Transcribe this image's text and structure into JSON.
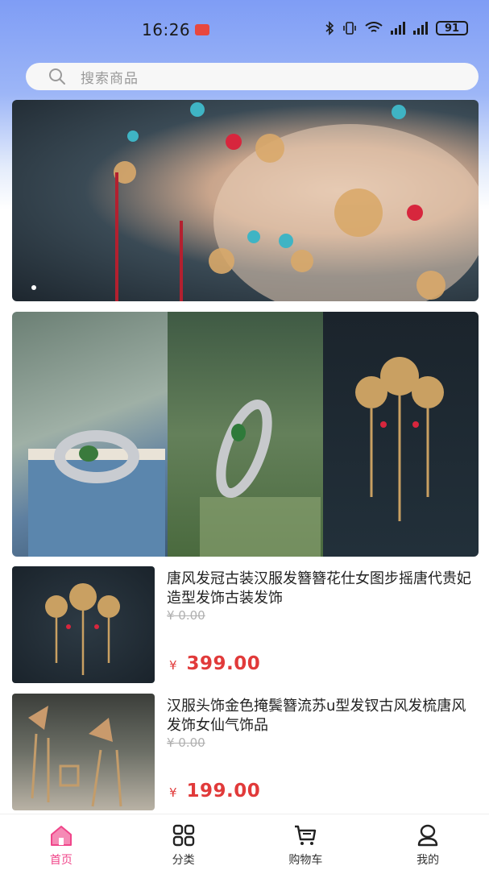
{
  "status_bar": {
    "time": "16:26",
    "battery": "91"
  },
  "search": {
    "placeholder": "搜索商品"
  },
  "colors": {
    "accent": "#f0458a",
    "price": "#e13a3a",
    "header_gradient_top": "#7f9df5"
  },
  "products": [
    {
      "title": "唐风发冠古装汉服发簪簪花仕女图步摇唐代贵妃造型发饰古装发饰",
      "original_price": "¥ 0.00",
      "currency": "¥",
      "price": "399.00"
    },
    {
      "title": "汉服头饰金色掩鬓簪流苏u型发钗古风发梳唐风发饰女仙气饰品",
      "original_price": "¥ 0.00",
      "currency": "¥",
      "price": "199.00"
    }
  ],
  "tabbar": {
    "items": [
      {
        "label": "首页",
        "icon": "home-icon",
        "active": true
      },
      {
        "label": "分类",
        "icon": "category-icon",
        "active": false
      },
      {
        "label": "购物车",
        "icon": "cart-icon",
        "active": false
      },
      {
        "label": "我的",
        "icon": "profile-icon",
        "active": false
      }
    ]
  }
}
